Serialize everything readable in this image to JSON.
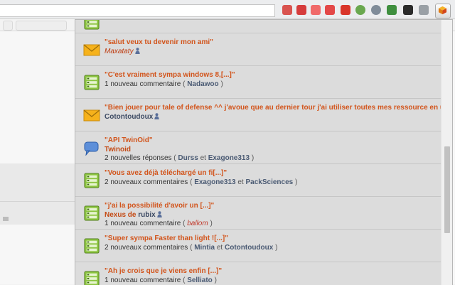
{
  "extension_icon": "package-cube-icon",
  "notifications": [
    {
      "id": "n0",
      "type": "thread",
      "icon": "thread-icon",
      "title": "",
      "author": "",
      "partial": true
    },
    {
      "id": "n1",
      "type": "message",
      "icon": "envelope-icon",
      "title": "\"salut veux tu devenir mon ami\"",
      "author": "Maxataty",
      "author_style": "italic",
      "author_icon": "user-icon",
      "count_text": "",
      "participants": []
    },
    {
      "id": "n2",
      "type": "thread",
      "icon": "thread-icon",
      "title": "\"C'est vraiment sympa windows 8,[...]\"",
      "author": "",
      "count_text": "1 nouveau commentaire",
      "participants": [
        "Nadawoo"
      ]
    },
    {
      "id": "n3",
      "type": "message",
      "icon": "envelope-icon",
      "title": "\"Bien jouer pour tale of defense ^^ j'avoue que au dernier tour j'ai utiliser toutes mes ressource en unité ^^\"\"",
      "author": "Cotontoudoux",
      "author_style": "user",
      "author_icon": "user-icon",
      "count_text": "",
      "participants": []
    },
    {
      "id": "n4",
      "type": "forum",
      "icon": "speech-bubble-icon",
      "title": "\"API TwinOid\"",
      "author": "Twinoid",
      "author_style": "group",
      "count_text": "2 nouvelles réponses",
      "participants": [
        "Durss",
        "Exagone313"
      ]
    },
    {
      "id": "n5",
      "type": "thread",
      "icon": "thread-icon",
      "title": "\"Vous avez déjà téléchargé un fi[...]\"",
      "author": "",
      "count_text": "2 nouveaux commentaires",
      "participants": [
        "Exagone313",
        "PackSciences"
      ]
    },
    {
      "id": "n6",
      "type": "thread",
      "icon": "thread-icon",
      "title": "\"j'ai la possibilité d'avoir un [...]\"",
      "author": "Nexus de",
      "author_style": "group",
      "author_user": "rubix",
      "author_icon": "user-icon",
      "count_text": "1 nouveau commentaire",
      "participants": [
        "ballom"
      ],
      "participants_italic": true
    },
    {
      "id": "n7",
      "type": "thread",
      "icon": "thread-icon",
      "title": "\"Super sympa Faster than light ![...]\"",
      "author": "",
      "count_text": "2 nouveaux commentaires",
      "participants": [
        "Mintia",
        "Cotontoudoux"
      ]
    },
    {
      "id": "n8",
      "type": "thread",
      "icon": "thread-icon",
      "title": "\"Ah je crois que je viens enfin [...]\"",
      "author": "",
      "count_text": "1 nouveau commentaire",
      "participants": [
        "Selliato"
      ]
    }
  ],
  "labels": {
    "and": "et",
    "open_paren": "(",
    "close_paren": ")"
  },
  "colors": {
    "title": "#d2541b",
    "author": "#bd3a0e",
    "user": "#3c4a63",
    "popup_bg": "#dcdcdc",
    "thread_icon": "#7ab32e",
    "envelope": "#f6b21b",
    "bubble": "#4a7fcf"
  }
}
